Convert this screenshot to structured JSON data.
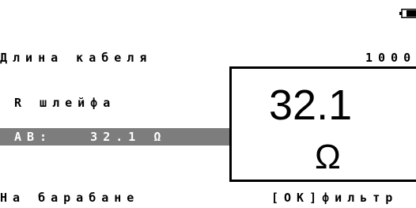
{
  "status": {
    "battery_icon": "battery-icon"
  },
  "rows": {
    "cable_length_label": "Длина кабеля",
    "cable_length_value": "1000",
    "loop_r_label": "R шлейфа",
    "ab_line": "АВ:   32.1 Ω",
    "drum_label": "На барабане",
    "ok_filter": "[OK]фильтр"
  },
  "display": {
    "value": "32.1",
    "unit": "Ω"
  },
  "colors": {
    "selected_row_bg": "#7d7d7d",
    "foreground": "#000000",
    "background": "#ffffff"
  }
}
